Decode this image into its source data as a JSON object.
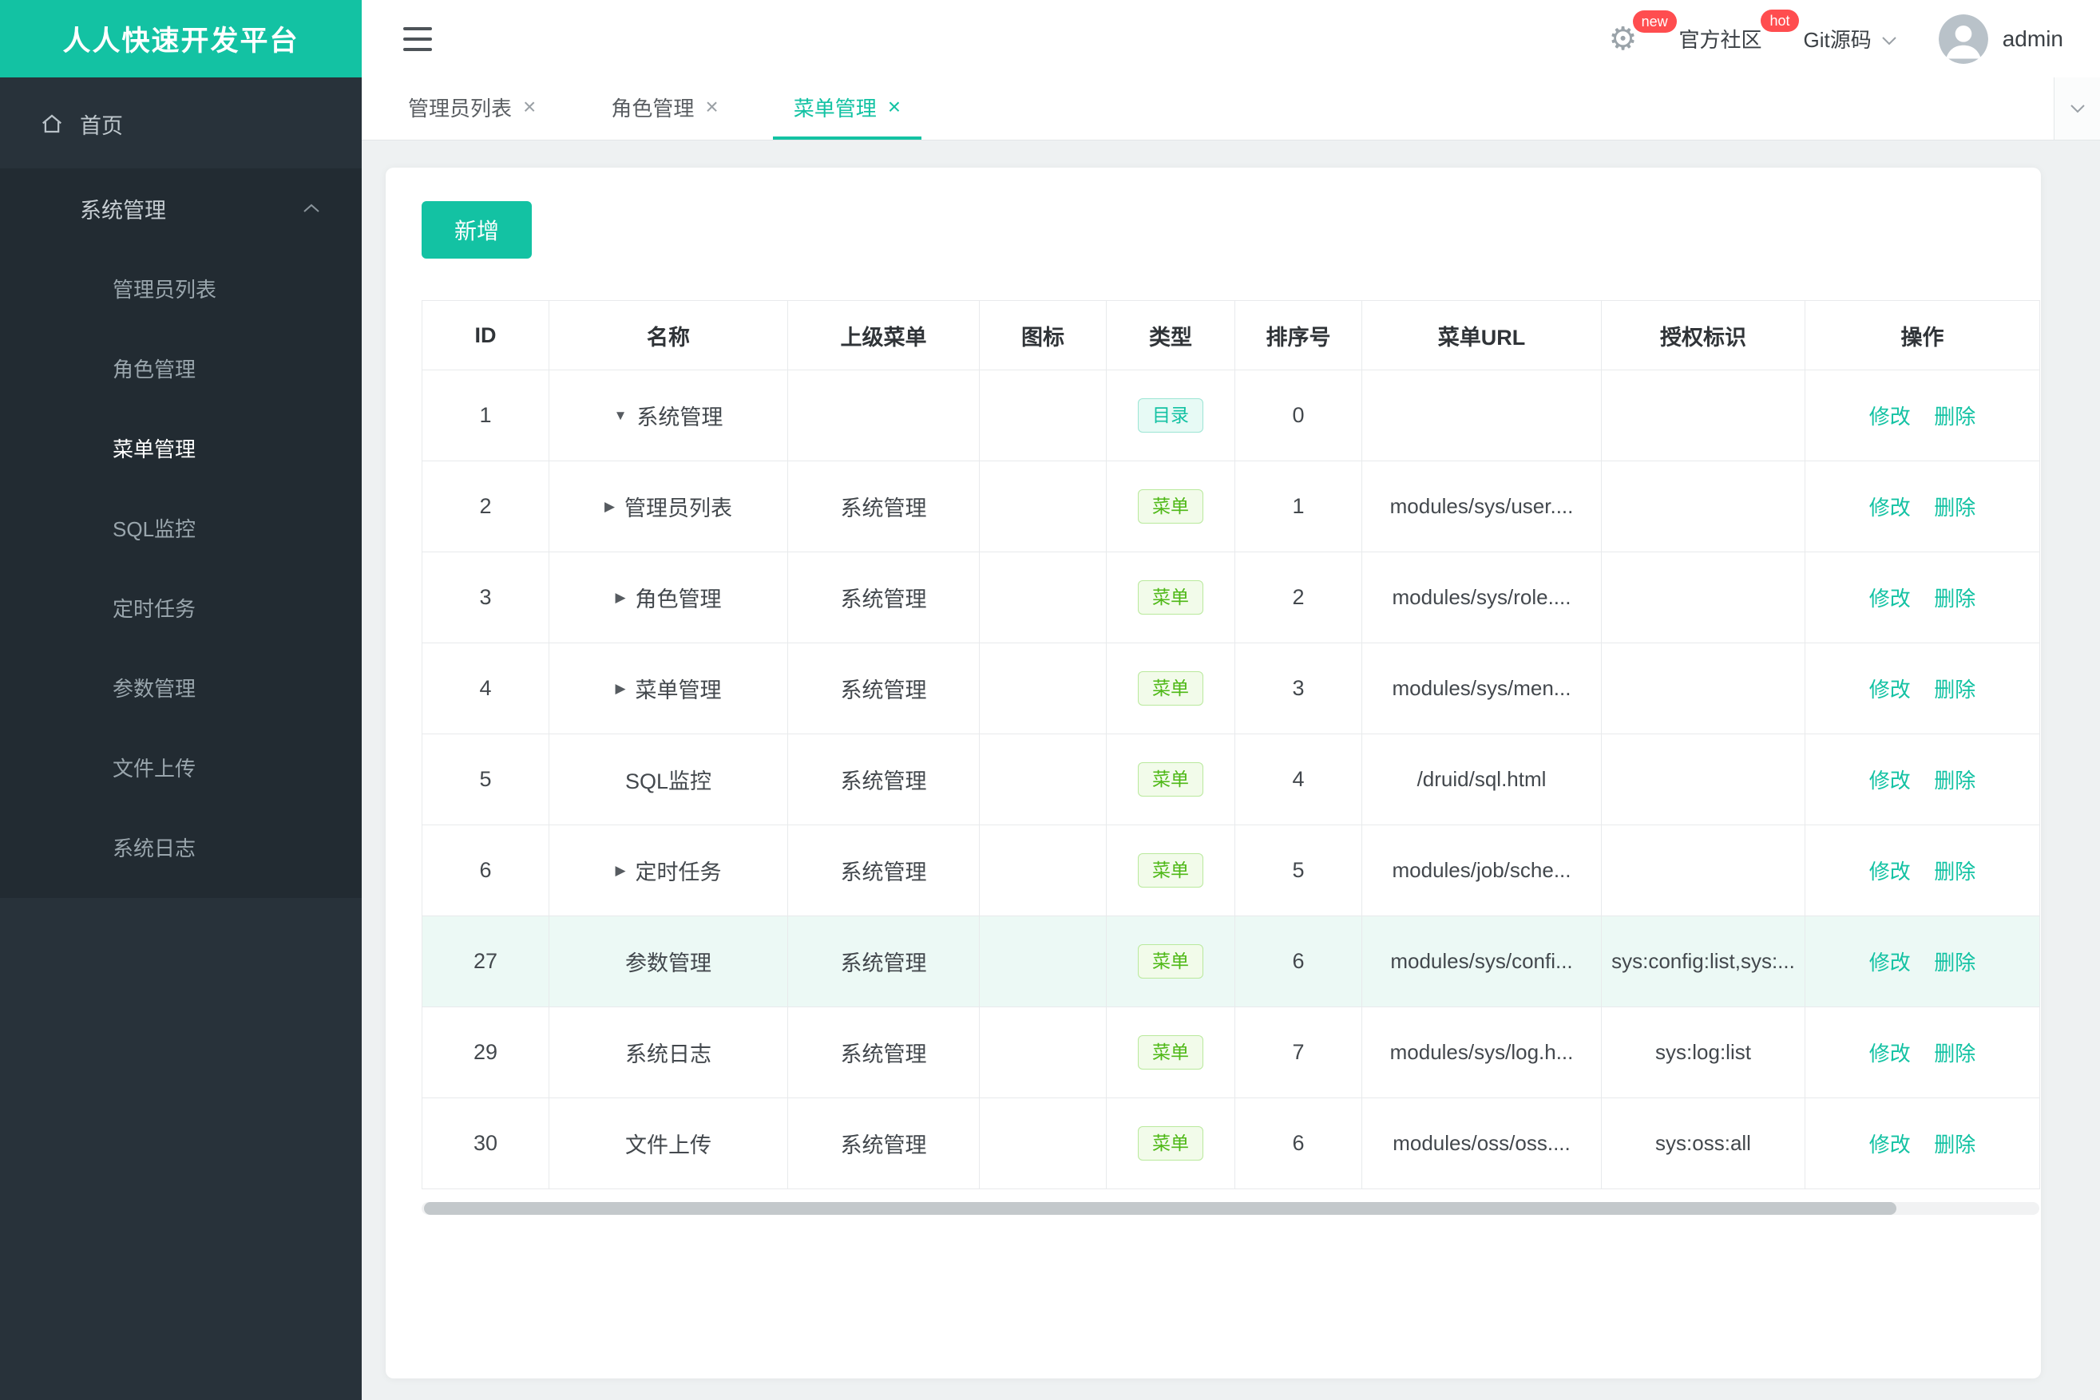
{
  "brand": {
    "title": "人人快速开发平台"
  },
  "colors": {
    "accent": "#13c2a3",
    "menu_badge_green": "#4eb816",
    "badge_red": "#ff4d4f",
    "sidebar_bg": "#28323a"
  },
  "icons": {
    "gear": "⚙",
    "close": "×",
    "arrow_down": "▼",
    "arrow_right": "▶",
    "home": "home-icon",
    "chevron_up": "chevron-up-icon",
    "chevron_down": "chevron-down-icon",
    "hamburger": "hamburger-icon"
  },
  "sidebar": {
    "home": {
      "label": "首页"
    },
    "group": {
      "label": "系统管理",
      "expanded": true
    },
    "items": [
      {
        "key": "admin-list",
        "label": "管理员列表",
        "active": false
      },
      {
        "key": "role-mgmt",
        "label": "角色管理",
        "active": false
      },
      {
        "key": "menu-mgmt",
        "label": "菜单管理",
        "active": true
      },
      {
        "key": "sql-monitor",
        "label": "SQL监控",
        "active": false
      },
      {
        "key": "scheduled-jobs",
        "label": "定时任务",
        "active": false
      },
      {
        "key": "config-mgmt",
        "label": "参数管理",
        "active": false
      },
      {
        "key": "file-upload",
        "label": "文件上传",
        "active": false
      },
      {
        "key": "system-log",
        "label": "系统日志",
        "active": false
      }
    ]
  },
  "header": {
    "badges": {
      "new": "new",
      "hot": "hot"
    },
    "community": "官方社区",
    "git": "Git源码",
    "user": "admin"
  },
  "tabs": [
    {
      "key": "admin-list",
      "label": "管理员列表",
      "active": false
    },
    {
      "key": "role-mgmt",
      "label": "角色管理",
      "active": false
    },
    {
      "key": "menu-mgmt",
      "label": "菜单管理",
      "active": true
    }
  ],
  "toolbar": {
    "add_label": "新增"
  },
  "table": {
    "columns": [
      "ID",
      "名称",
      "上级菜单",
      "图标",
      "类型",
      "排序号",
      "菜单URL",
      "授权标识",
      "操作"
    ],
    "actions": {
      "edit": "修改",
      "delete": "删除"
    },
    "rows": [
      {
        "id": "1",
        "arrow": "down",
        "name": "系统管理",
        "parent": "",
        "icon": "",
        "type": "目录",
        "type_kind": "dir",
        "order": "0",
        "url": "",
        "perms": "",
        "highlight": false
      },
      {
        "id": "2",
        "arrow": "right",
        "name": "管理员列表",
        "parent": "系统管理",
        "icon": "",
        "type": "菜单",
        "type_kind": "menu",
        "order": "1",
        "url": "modules/sys/user....",
        "perms": "",
        "highlight": false
      },
      {
        "id": "3",
        "arrow": "right",
        "name": "角色管理",
        "parent": "系统管理",
        "icon": "",
        "type": "菜单",
        "type_kind": "menu",
        "order": "2",
        "url": "modules/sys/role....",
        "perms": "",
        "highlight": false
      },
      {
        "id": "4",
        "arrow": "right",
        "name": "菜单管理",
        "parent": "系统管理",
        "icon": "",
        "type": "菜单",
        "type_kind": "menu",
        "order": "3",
        "url": "modules/sys/men...",
        "perms": "",
        "highlight": false
      },
      {
        "id": "5",
        "arrow": null,
        "name": "SQL监控",
        "parent": "系统管理",
        "icon": "",
        "type": "菜单",
        "type_kind": "menu",
        "order": "4",
        "url": "/druid/sql.html",
        "perms": "",
        "highlight": false
      },
      {
        "id": "6",
        "arrow": "right",
        "name": "定时任务",
        "parent": "系统管理",
        "icon": "",
        "type": "菜单",
        "type_kind": "menu",
        "order": "5",
        "url": "modules/job/sche...",
        "perms": "",
        "highlight": false
      },
      {
        "id": "27",
        "arrow": null,
        "name": "参数管理",
        "parent": "系统管理",
        "icon": "",
        "type": "菜单",
        "type_kind": "menu",
        "order": "6",
        "url": "modules/sys/confi...",
        "perms": "sys:config:list,sys:...",
        "highlight": true
      },
      {
        "id": "29",
        "arrow": null,
        "name": "系统日志",
        "parent": "系统管理",
        "icon": "",
        "type": "菜单",
        "type_kind": "menu",
        "order": "7",
        "url": "modules/sys/log.h...",
        "perms": "sys:log:list",
        "highlight": false
      },
      {
        "id": "30",
        "arrow": null,
        "name": "文件上传",
        "parent": "系统管理",
        "icon": "",
        "type": "菜单",
        "type_kind": "menu",
        "order": "6",
        "url": "modules/oss/oss....",
        "perms": "sys:oss:all",
        "highlight": false
      }
    ]
  }
}
